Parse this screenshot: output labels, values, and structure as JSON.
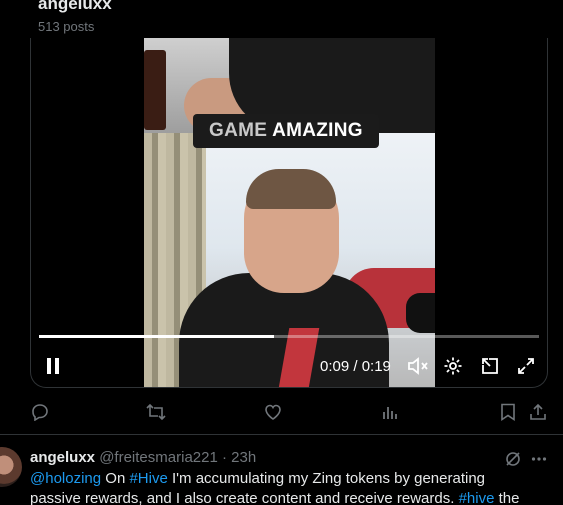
{
  "header": {
    "name": "angeluxx",
    "posts_count": "513 posts"
  },
  "video": {
    "caption_word1": "GAME",
    "caption_word2": "AMAZING",
    "time": "0:09 / 0:19",
    "progress": 0.47
  },
  "post": {
    "name": "angeluxx",
    "handle": "@freitesmaria221",
    "time": "23h",
    "line1": {
      "mention": "@holozing",
      "t1": " On ",
      "tag1": "#Hive",
      "t2": " I'm accumulating my Zing tokens by generating"
    },
    "line2": {
      "t1": "passive rewards, and I also create content and receive rewards. ",
      "tag": "#hive",
      "t2": " the"
    }
  },
  "colors": {
    "background": "#000000",
    "text": "#e7e9ea",
    "muted": "#71767b",
    "link": "#1d9bf0",
    "border": "#2f3336"
  },
  "icons": {
    "controls": [
      "pause-icon",
      "mute-icon",
      "settings-icon",
      "pip-icon",
      "fullscreen-icon"
    ],
    "actions": [
      "reply-icon",
      "repost-icon",
      "like-icon",
      "views-icon",
      "bookmark-icon",
      "share-icon"
    ],
    "post": [
      "grok-icon",
      "more-icon"
    ]
  }
}
